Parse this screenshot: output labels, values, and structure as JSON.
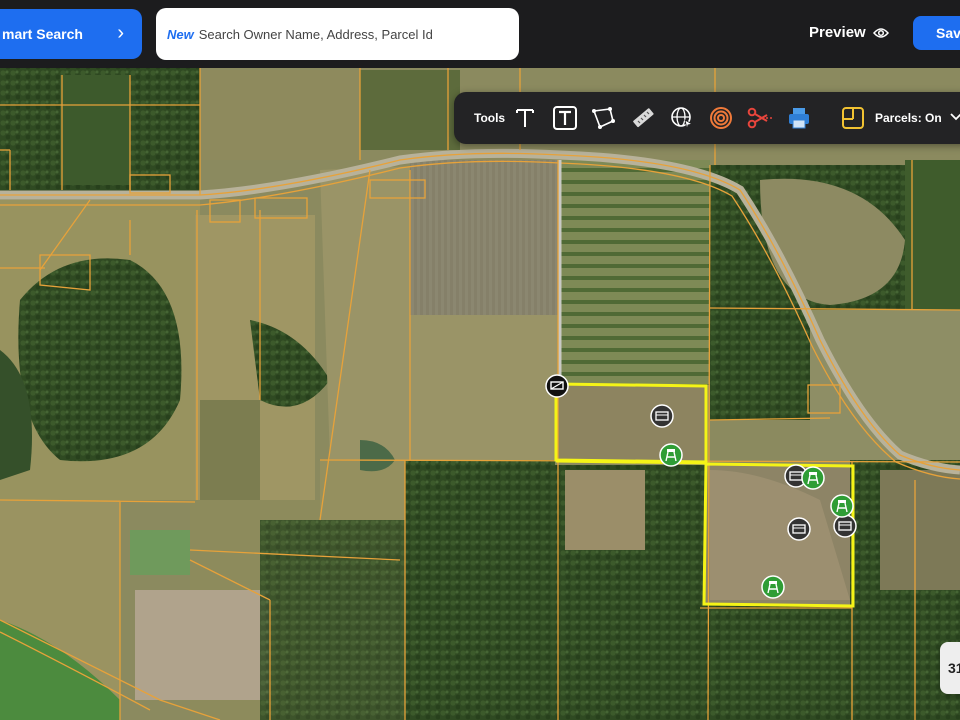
{
  "header": {
    "smart_search_label": "mart Search",
    "search_new_tag": "New",
    "search_placeholder": "Search Owner Name, Address, Parcel Id",
    "preview_label": "Preview",
    "save_label": "Sav"
  },
  "toolbar": {
    "title": "Tools",
    "tools": [
      {
        "name": "text-tool",
        "icon": "text-icon"
      },
      {
        "name": "text-box-tool",
        "icon": "text-box-icon"
      },
      {
        "name": "polygon-tool",
        "icon": "polygon-icon"
      },
      {
        "name": "measure-tool",
        "icon": "ruler-icon"
      },
      {
        "name": "globe-tool",
        "icon": "globe-pointer-icon"
      },
      {
        "name": "radius-tool",
        "icon": "concentric-circles-icon"
      },
      {
        "name": "cut-tool",
        "icon": "scissors-icon"
      },
      {
        "name": "print-tool",
        "icon": "printer-icon"
      },
      {
        "name": "layers-tool",
        "icon": "layout-icon"
      }
    ],
    "parcels_label": "Parcels: On"
  },
  "map": {
    "selected_parcel_color": "#f4f417",
    "parcel_line_color": "#e7a23a",
    "markers": [
      {
        "type": "gate",
        "icon": "gate-icon"
      },
      {
        "type": "structure",
        "icon": "cabin-icon"
      },
      {
        "type": "structure",
        "icon": "cabin-icon"
      },
      {
        "type": "structure",
        "icon": "cabin-icon"
      },
      {
        "type": "structure",
        "icon": "cabin-icon"
      },
      {
        "type": "deer-stand",
        "icon": "tower-stand-icon"
      },
      {
        "type": "deer-stand",
        "icon": "tower-stand-icon"
      },
      {
        "type": "deer-stand",
        "icon": "tower-stand-icon"
      },
      {
        "type": "deer-stand",
        "icon": "tower-stand-icon"
      },
      {
        "type": "deer-stand",
        "icon": "tower-stand-icon"
      }
    ]
  },
  "zoom_widget": {
    "label": "31"
  }
}
